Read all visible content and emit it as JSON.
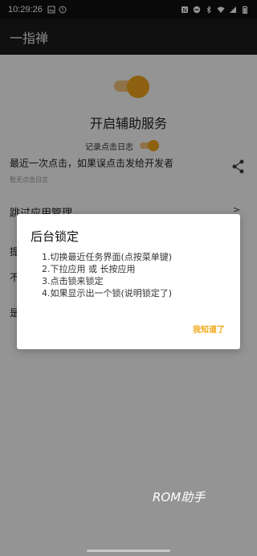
{
  "status_bar": {
    "time": "10:29:26",
    "left_icons": [
      "image-icon",
      "alert-icon"
    ],
    "right_icons": [
      "nfc-icon",
      "dnd-icon",
      "bluetooth-icon",
      "wifi-icon",
      "signal-icon",
      "battery-icon"
    ]
  },
  "app_bar": {
    "title": "一指禅"
  },
  "main": {
    "service_toggle_on": true,
    "service_title": "开启辅助服务",
    "log_label": "记录点击日志",
    "log_toggle_on": true,
    "report_text": "最近一次点击，如果误点击发给开发者",
    "report_sub": "暂无点击日志",
    "skip_label": "跳过应用管理",
    "skip_chevron": ">",
    "partial_1": "提",
    "partial_2": "不",
    "partial_3": "是"
  },
  "dialog": {
    "title": "后台锁定",
    "steps": [
      "1.切换最近任务界面(点按菜单键)",
      "2.下拉应用 或 长按应用",
      "3.点击锁来锁定",
      "4.如果显示出一个锁(说明锁定了)"
    ],
    "confirm_label": "我知道了"
  },
  "watermark": "ROM助手",
  "colors": {
    "accent": "#f3a81a",
    "accent_light": "#f4c77a",
    "app_bar": "#1c1c1c",
    "scrim": "rgba(0,0,0,0.42)"
  }
}
